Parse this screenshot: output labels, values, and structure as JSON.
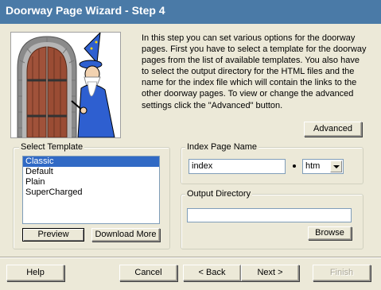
{
  "window": {
    "title": "Doorway Page Wizard - Step 4"
  },
  "intro": {
    "text": "In this step you can  set various options for the doorway pages.  First you have to select a template for the doorway pages from the list of available templates. You also have to select the output directory for the HTML files and the name for the index file which will contain the links to the other doorway pages. To view or change the advanced settings  click the \"Advanced\" button."
  },
  "advanced_label": "Advanced",
  "template": {
    "group_label": "Select Template",
    "items": [
      "Classic",
      "Default",
      "Plain",
      "SuperCharged"
    ],
    "selected": "Classic",
    "preview_label": "Preview",
    "download_label": "Download More"
  },
  "index_page": {
    "group_label": "Index Page Name",
    "value": "index",
    "extension": "htm"
  },
  "output_dir": {
    "group_label": "Output Directory",
    "value": "",
    "browse_label": "Browse"
  },
  "footer": {
    "help_label": "Help",
    "cancel_label": "Cancel",
    "back_label": "< Back",
    "next_label": "Next >",
    "finish_label": "Finish"
  },
  "colors": {
    "header": "#4a7aa7",
    "selection": "#316ac5",
    "wizard_robe": "#2e5fd0",
    "door": "#a0523a"
  }
}
